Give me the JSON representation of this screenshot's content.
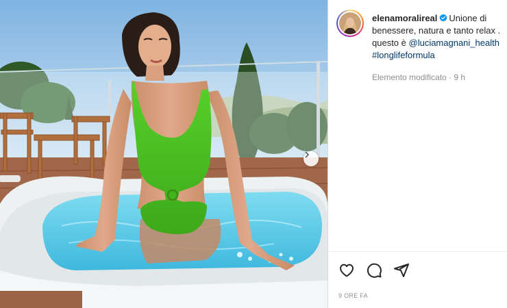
{
  "post": {
    "username": "elenamoralireal",
    "caption_text_1": "Unione di",
    "caption_text_2": "benessere, natura e tanto relax .",
    "caption_text_3": "questo è",
    "mention": "@luciamagnani_health",
    "hashtag": "#longlifeformula",
    "edited_label": "Elemento modificato · 9 h",
    "time_ago": "9 ORE FA",
    "verified": true
  },
  "icons": {
    "like": "heart-icon",
    "comment": "comment-icon",
    "share": "share-icon",
    "next": "chevron-right-icon",
    "verified": "verified-badge-icon"
  },
  "colors": {
    "link": "#00376b",
    "verified": "#0095f6",
    "muted": "#8e8e8e",
    "swimsuit": "#4cc21f",
    "pool_water": "#5fd0ea"
  }
}
